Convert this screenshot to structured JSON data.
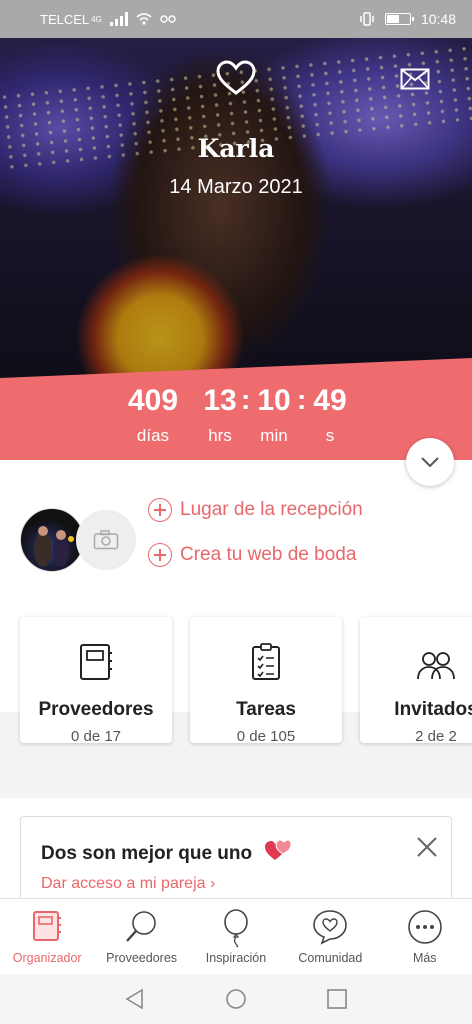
{
  "status_bar": {
    "carrier": "TELCEL",
    "signal_label": "4G",
    "time": "10:48",
    "battery_level": 0.55
  },
  "hero": {
    "name": "Karla",
    "date": "14 Marzo 2021"
  },
  "countdown": [
    {
      "value": "409",
      "label": "días"
    },
    {
      "value": "13",
      "label": "hrs"
    },
    {
      "value": "10",
      "label": "min"
    },
    {
      "value": "49",
      "label": "s"
    }
  ],
  "actions": {
    "reception": "Lugar de la recepción",
    "website": "Crea tu web de boda"
  },
  "cards": [
    {
      "title": "Proveedores",
      "count": "0 de 17",
      "icon": "notebook-icon"
    },
    {
      "title": "Tareas",
      "count": "0 de 105",
      "icon": "checklist-icon"
    },
    {
      "title": "Invitados",
      "count": "2 de 2",
      "icon": "guests-icon"
    }
  ],
  "invite": {
    "title": "Dos son mejor que uno",
    "link": "Dar acceso a mi pareja ›"
  },
  "tabs": [
    {
      "label": "Organizador",
      "icon": "organizer-icon",
      "active": true
    },
    {
      "label": "Proveedores",
      "icon": "search-icon",
      "active": false
    },
    {
      "label": "Inspiración",
      "icon": "balloon-icon",
      "active": false
    },
    {
      "label": "Comunidad",
      "icon": "community-icon",
      "active": false
    },
    {
      "label": "Más",
      "icon": "more-icon",
      "active": false
    }
  ],
  "colors": {
    "accent": "#ee6b6e",
    "link": "#e8676a"
  }
}
